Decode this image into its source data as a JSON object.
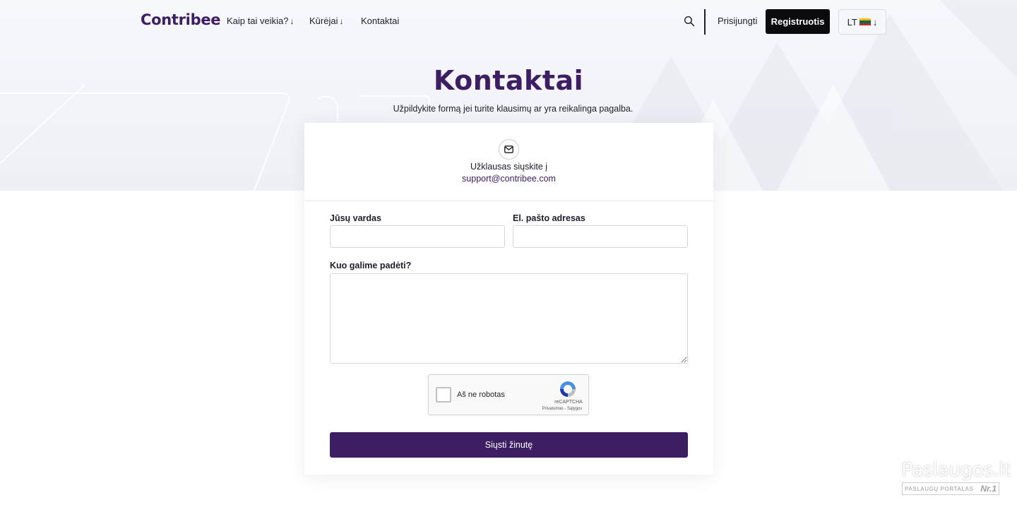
{
  "header": {
    "logo": "Contribee",
    "nav": [
      {
        "label": "Kaip tai veikia?",
        "arrow": "↓"
      },
      {
        "label": "Kūrėjai",
        "arrow": "↓"
      },
      {
        "label": "Kontaktai"
      }
    ],
    "login_label": "Prisijungti",
    "register_label": "Registruotis",
    "language": {
      "code": "LT",
      "arrow": "↓",
      "flag_colors": [
        "#fdb913",
        "#006a44",
        "#c1272d"
      ]
    }
  },
  "hero": {
    "title": "Kontaktai",
    "subtitle": "Užpildykite formą jei turite klausimų ar yra reikalinga pagalba."
  },
  "contact": {
    "inquiry_text": "Užklausas siųskite į",
    "email": "support@contribee.com"
  },
  "form": {
    "name_label": "Jūsų vardas",
    "name_value": "",
    "email_label": "El. pašto adresas",
    "email_value": "",
    "message_label": "Kuo galime padėti?",
    "message_value": "",
    "recaptcha": {
      "label": "Aš ne robotas",
      "brand": "reCAPTCHA",
      "terms": "Privatumas - Sąlygos"
    },
    "submit_label": "Siųsti žinutę"
  },
  "watermark": {
    "title": "Paslaugos.lt",
    "subtitle": "PASLAUGŲ PORTALAS",
    "badge": "Nr.1"
  },
  "colors": {
    "brand": "#3d1e63",
    "dark_button": "#0b0b0f",
    "hero_bg": "#f2f3f8"
  }
}
